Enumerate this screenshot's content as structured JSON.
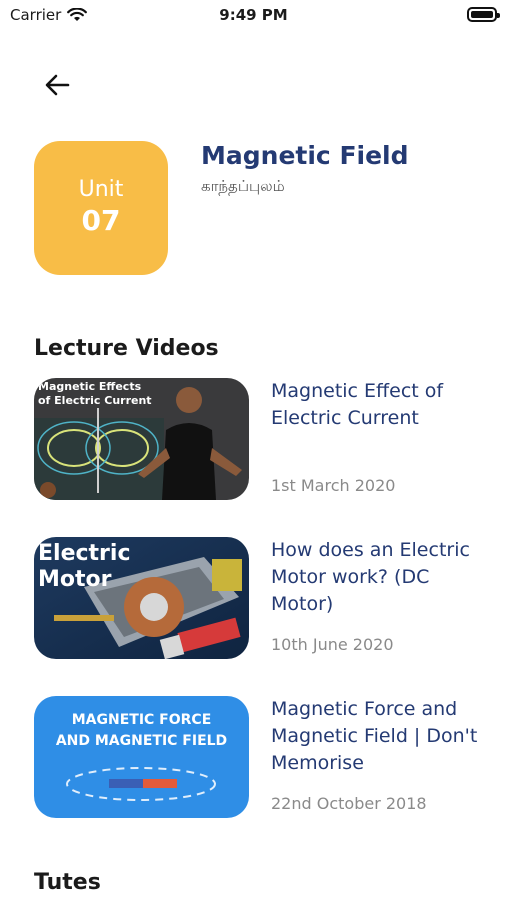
{
  "status": {
    "carrier": "Carrier",
    "time": "9:49 PM"
  },
  "unit": {
    "label": "Unit",
    "number": "07"
  },
  "header": {
    "title": "Magnetic Field",
    "subtitle": "காந்தப்புலம்"
  },
  "sections": {
    "videos": "Lecture Videos",
    "tutes": "Tutes"
  },
  "videos": [
    {
      "title": "Magnetic Effect of Electric Current",
      "date": "1st March 2020",
      "thumb_text": [
        "Magnetic Effects",
        "of Electric Current"
      ]
    },
    {
      "title": "How does an Electric Motor work? (DC Motor)",
      "date": "10th June 2020",
      "thumb_text": [
        "Electric",
        "Motor"
      ]
    },
    {
      "title": "Magnetic Force and Magnetic Field | Don't Memorise",
      "date": "22nd October 2018",
      "thumb_text": [
        "MAGNETIC FORCE",
        "AND MAGNETIC FIELD"
      ]
    }
  ],
  "colors": {
    "accent": "#243a73",
    "unit_card": "#F8BD47",
    "thumb3_bg": "#2F8EE6"
  }
}
